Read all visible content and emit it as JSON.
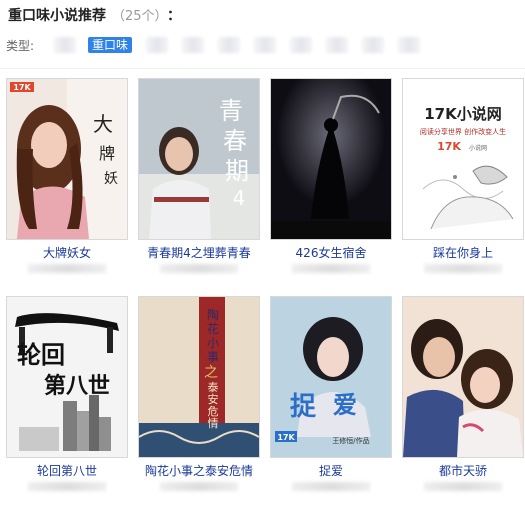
{
  "header": {
    "title": "重口味小说推荐",
    "count": "（25个）",
    "colon": "："
  },
  "filters": {
    "label": "类型:",
    "active_label": "重口味"
  },
  "books": [
    {
      "name": "大牌妖女",
      "cover_text": [
        "大",
        "牌",
        "妖"
      ],
      "cover_badge": "17K"
    },
    {
      "name": "青春期4之埋葬青春",
      "cover_text": [
        "青",
        "春",
        "期",
        "4"
      ]
    },
    {
      "name": "426女生宿舍"
    },
    {
      "name": "踩在你身上",
      "cover_text": [
        "17K小说网",
        "阅读分享世界 创作改变人生",
        "17K",
        "小说网"
      ]
    },
    {
      "name": "轮回第八世",
      "cover_text": [
        "轮回",
        "第八世"
      ]
    },
    {
      "name": "陶花小事之泰安危情",
      "cover_text": [
        "陶",
        "花",
        "小",
        "事",
        "之",
        "泰",
        "安",
        "危",
        "情"
      ]
    },
    {
      "name": "捉爱",
      "cover_text": [
        "捉",
        "爱",
        "17K",
        "王修恒/作品"
      ]
    },
    {
      "name": "都市天骄"
    }
  ],
  "colors": {
    "accent": "#2f82e8",
    "link": "#1a3a9a"
  }
}
